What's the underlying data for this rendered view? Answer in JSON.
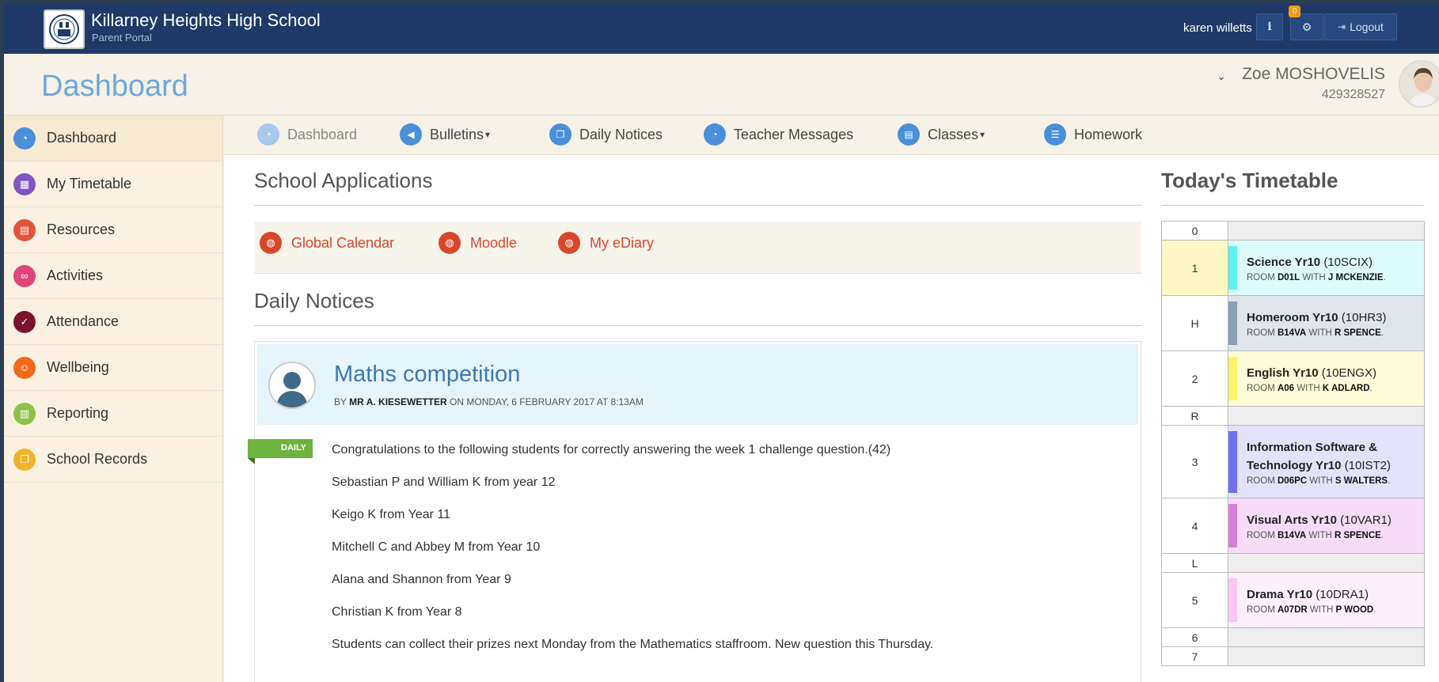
{
  "topbar": {
    "school_name": "Killarney Heights High School",
    "portal_name": "Parent Portal",
    "user_name": "karen willetts",
    "info_icon": "info-icon",
    "gear_icon": "gear-icon",
    "notification_count": "0",
    "logout_label": "Logout",
    "background_color": "#1f3a68"
  },
  "header": {
    "page_title": "Dashboard",
    "student_name": "Zoe MOSHOVELIS",
    "student_id": "429328527"
  },
  "sidebar": {
    "items": [
      {
        "label": "Dashboard",
        "icon": "dashboard-icon",
        "color": "#4a90d9"
      },
      {
        "label": "My Timetable",
        "icon": "calendar-icon",
        "color": "#7e57c2"
      },
      {
        "label": "Resources",
        "icon": "book-icon",
        "color": "#e2533b"
      },
      {
        "label": "Activities",
        "icon": "bicycle-icon",
        "color": "#e0457b"
      },
      {
        "label": "Attendance",
        "icon": "check-circle-icon",
        "color": "#7b1230"
      },
      {
        "label": "Wellbeing",
        "icon": "smile-icon",
        "color": "#f26a1b"
      },
      {
        "label": "Reporting",
        "icon": "bar-chart-icon",
        "color": "#8bc34a"
      },
      {
        "label": "School Records",
        "icon": "records-icon",
        "color": "#f0b429"
      }
    ]
  },
  "nav": {
    "items": [
      {
        "label": "Dashboard",
        "icon": "dashboard-icon"
      },
      {
        "label": "Bulletins",
        "icon": "megaphone-icon"
      },
      {
        "label": "Daily Notices",
        "icon": "copy-icon"
      },
      {
        "label": "Teacher Messages",
        "icon": "dashboard-icon"
      },
      {
        "label": "Classes",
        "icon": "book-icon"
      },
      {
        "label": "Homework",
        "icon": "list-icon"
      }
    ]
  },
  "school_applications": {
    "title": "School Applications",
    "links": [
      {
        "label": "Global Calendar",
        "icon": "globe-icon"
      },
      {
        "label": "Moodle",
        "icon": "globe-icon"
      },
      {
        "label": "My eDiary",
        "icon": "globe-icon"
      }
    ],
    "accent_color": "#d9472b"
  },
  "daily_notices": {
    "title": "Daily Notices",
    "notice": {
      "title": "Maths competition",
      "by_label": "BY",
      "author": "MR A. KIESEWETTER",
      "date_text": "ON MONDAY, 6 FEBRUARY 2017 AT 8:13AM",
      "ribbon": "DAILY",
      "lines": [
        "Congratulations to the following students for correctly answering the week 1 challenge question.(42)",
        "Sebastian P and William K from year 12",
        "Keigo K from Year 11",
        "Mitchell C and Abbey M from Year 10",
        "Alana and Shannon from Year 9",
        "Christian K from Year 8",
        "Students can collect their prizes next Monday from the Mathematics staffroom. New question this Thursday."
      ]
    }
  },
  "timetable": {
    "title": "Today's Timetable",
    "room_label": "ROOM",
    "with_label": "WITH",
    "rows": [
      {
        "period": "0"
      },
      {
        "period": "1",
        "subject": "Science Yr10",
        "code": "(10SCIX)",
        "room": "D01L",
        "teacher": "J MCKENZIE",
        "bar": "#5ff0f0",
        "bg": "#ddfbfb",
        "highlight": true
      },
      {
        "period": "H",
        "subject": "Homeroom Yr10",
        "code": "(10HR3)",
        "room": "B14VA",
        "teacher": "R SPENCE",
        "bar": "#8aa0b4",
        "bg": "#dfe5ea"
      },
      {
        "period": "2",
        "subject": "English Yr10",
        "code": "(10ENGX)",
        "room": "A06",
        "teacher": "K ADLARD",
        "bar": "#fff36b",
        "bg": "#fffbd8"
      },
      {
        "period": "R"
      },
      {
        "period": "3",
        "subject": "Information Software & Technology Yr10",
        "code": "(10IST2)",
        "room": "D06PC",
        "teacher": "S WALTERS",
        "bar": "#7070ee",
        "bg": "#e2e2fb"
      },
      {
        "period": "4",
        "subject": "Visual Arts Yr10",
        "code": "(10VAR1)",
        "room": "B14VA",
        "teacher": "R SPENCE",
        "bar": "#d77fd8",
        "bg": "#f6dcf6"
      },
      {
        "period": "L"
      },
      {
        "period": "5",
        "subject": "Drama Yr10",
        "code": "(10DRA1)",
        "room": "A07DR",
        "teacher": "P WOOD",
        "bar": "#fbc5f6",
        "bg": "#fdf0fc"
      },
      {
        "period": "6"
      },
      {
        "period": "7"
      }
    ]
  }
}
